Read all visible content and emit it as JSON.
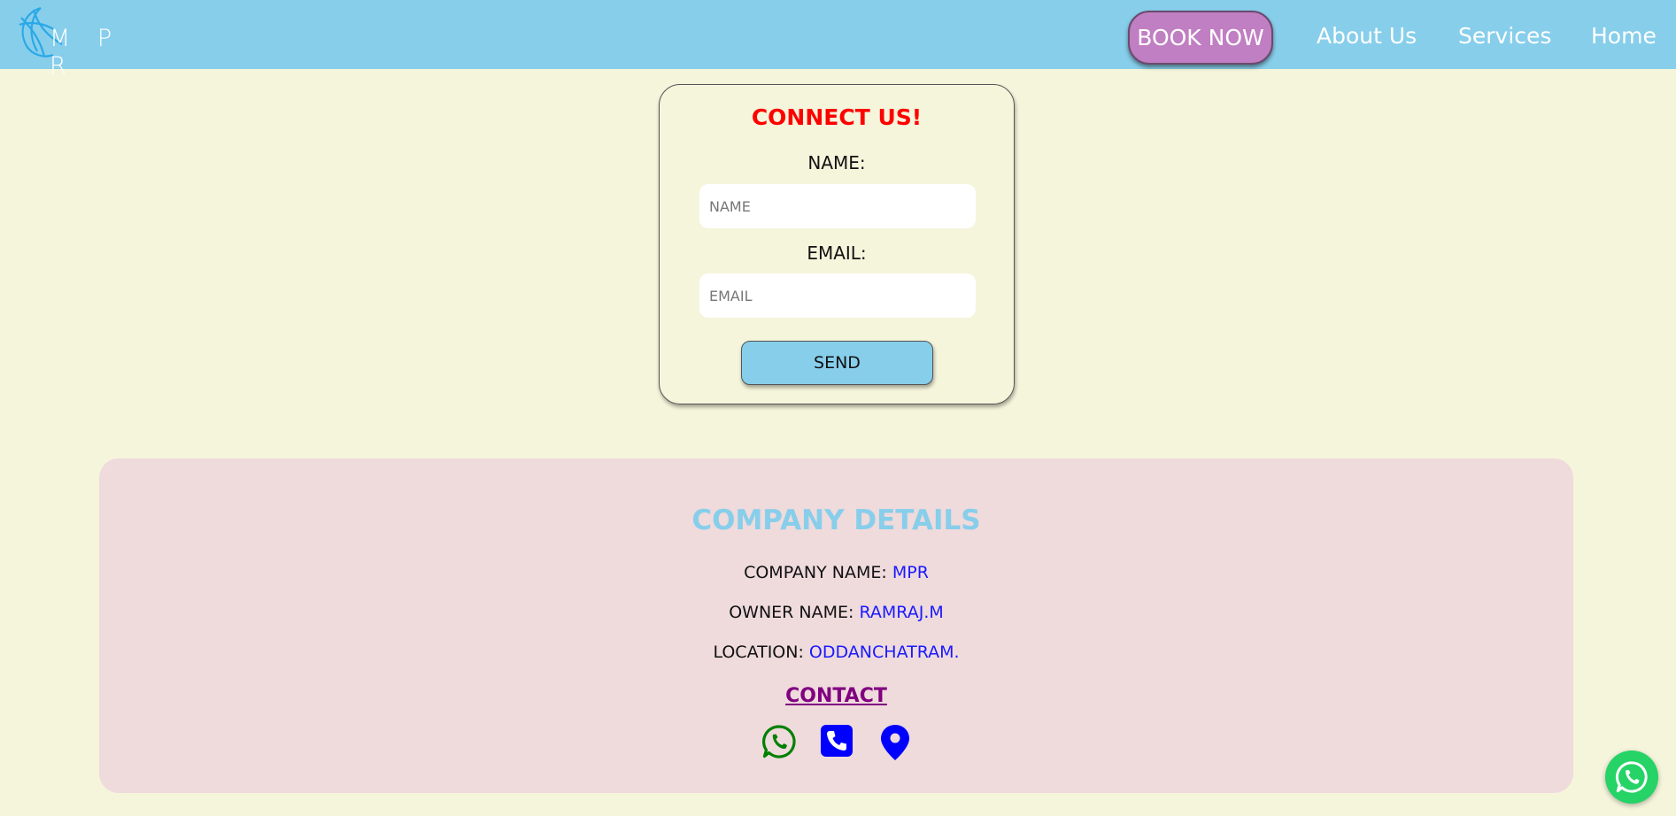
{
  "nav": {
    "logo_text": "M P R",
    "book_now": "BOOK NOW",
    "links": [
      "About Us",
      "Services",
      "Home"
    ]
  },
  "form": {
    "title": "CONNECT US!",
    "name_label": "NAME:",
    "name_placeholder": "NAME",
    "email_label": "EMAIL:",
    "email_placeholder": "EMAIL",
    "send_label": "SEND"
  },
  "company": {
    "title": "COMPANY DETAILS",
    "name_label": "COMPANY NAME:",
    "name_value": "MPR",
    "owner_label": "OWNER NAME:",
    "owner_value": "RAMRAJ.M",
    "location_label": "LOCATION:",
    "location_value": "ODDANCHATRAM.",
    "contact_label": "CONTACT",
    "icons": [
      "whatsapp-icon",
      "phone-icon",
      "location-pin-icon"
    ]
  },
  "colors": {
    "navbar": "#87ceeb",
    "page_bg": "#f5f5dc",
    "book_button": "#c07fc2",
    "form_title": "#ff0000",
    "company_card": "#efdadc",
    "company_title": "#87ceeb",
    "detail_value": "#1a1aff",
    "contact_link": "#800080",
    "whatsapp": "#008000",
    "phone": "#0000ff",
    "location": "#0000ff",
    "floating_whatsapp": "#25d366"
  }
}
